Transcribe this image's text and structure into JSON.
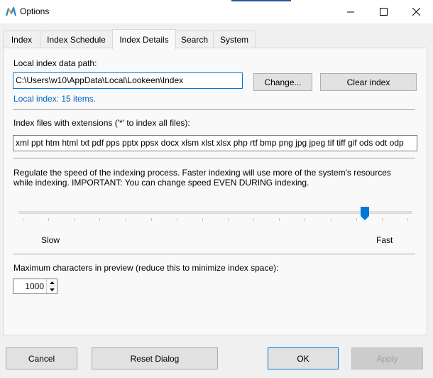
{
  "window": {
    "title": "Options",
    "accent_color": "#2b5797"
  },
  "tabs": [
    {
      "label": "Index",
      "active": false
    },
    {
      "label": "Index Schedule",
      "active": false
    },
    {
      "label": "Index Details",
      "active": true
    },
    {
      "label": "Search",
      "active": false
    },
    {
      "label": "System",
      "active": false
    }
  ],
  "index_path": {
    "label": "Local index data path:",
    "value": "C:\\Users\\w10\\AppData\\Local\\Lookeen\\Index",
    "change_button": "Change...",
    "clear_button": "Clear index",
    "status": "Local index: 15 items.",
    "status_color": "#0066cc"
  },
  "extensions": {
    "label": "Index files with extensions ('*' to index all files):",
    "value": "xml ppt htm html txt pdf pps pptx ppsx docx xlsm xlst xlsx php rtf bmp png jpg jpeg tif tiff gif ods odt odp"
  },
  "speed": {
    "description_line1": "Regulate the speed of the indexing process. Faster indexing will use more of the system's resources",
    "description_line2": "while indexing. IMPORTANT: You can change speed EVEN DURING indexing.",
    "slow_label": "Slow",
    "fast_label": "Fast",
    "level": 0.89
  },
  "preview": {
    "label": "Maximum characters in preview (reduce this to minimize index space):",
    "value": "1000"
  },
  "footer": {
    "cancel": "Cancel",
    "reset": "Reset Dialog",
    "ok": "OK",
    "apply": "Apply"
  }
}
